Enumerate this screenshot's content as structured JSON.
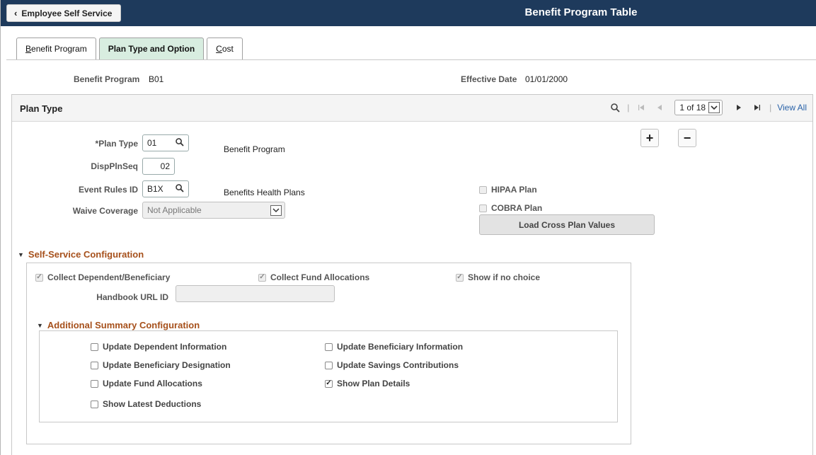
{
  "header": {
    "back_label": "Employee Self Service",
    "title": "Benefit Program Table"
  },
  "tabs": [
    {
      "label_ul": "B",
      "label_rest": "enefit Program",
      "active": false
    },
    {
      "label_ul": "",
      "label_rest": "Plan Type and Option",
      "active": true
    },
    {
      "label_ul": "C",
      "label_rest": "ost",
      "active": false
    }
  ],
  "program": {
    "program_label": "Benefit Program",
    "program_value": "B01",
    "effdt_label": "Effective Date",
    "effdt_value": "01/01/2000"
  },
  "plan_type_section": {
    "title": "Plan Type",
    "pager_text": "1 of 18",
    "view_all": "View All",
    "icons": [
      "search-icon",
      "first-icon",
      "prev-icon",
      "next-icon",
      "last-icon"
    ]
  },
  "fields": {
    "plan_type_label": "*Plan Type",
    "plan_type_value": "01",
    "plan_type_desc": "Benefit Program",
    "disp_seq_label": "DispPlnSeq",
    "disp_seq_value": "02",
    "event_rules_label": "Event Rules ID",
    "event_rules_value": "B1X",
    "event_rules_desc": "Benefits Health Plans",
    "waive_label": "Waive Coverage",
    "waive_value": "Not Applicable",
    "hipaa_label": "HIPAA Plan",
    "hipaa_checked": false,
    "cobra_label": "COBRA Plan",
    "cobra_checked": false,
    "load_button": "Load Cross Plan Values",
    "add_row": "+",
    "delete_row": "−"
  },
  "self_service": {
    "title": "Self-Service Configuration",
    "collect_dep_label": "Collect Dependent/Beneficiary",
    "collect_dep_checked": true,
    "collect_fund_label": "Collect Fund Allocations",
    "collect_fund_checked": true,
    "show_no_choice_label": "Show if no choice",
    "show_no_choice_checked": true,
    "handbook_label": "Handbook URL ID",
    "handbook_value": ""
  },
  "additional_summary": {
    "title": "Additional Summary Configuration",
    "items": [
      {
        "label": "Update Dependent Information",
        "checked": false
      },
      {
        "label": "Update Beneficiary Information",
        "checked": false
      },
      {
        "label": "Update Beneficiary Designation",
        "checked": false
      },
      {
        "label": "Update Savings Contributions",
        "checked": false
      },
      {
        "label": "Update Fund Allocations",
        "checked": false
      },
      {
        "label": "Show Plan Details",
        "checked": true
      },
      {
        "label": "Show Latest Deductions",
        "checked": false
      }
    ]
  }
}
